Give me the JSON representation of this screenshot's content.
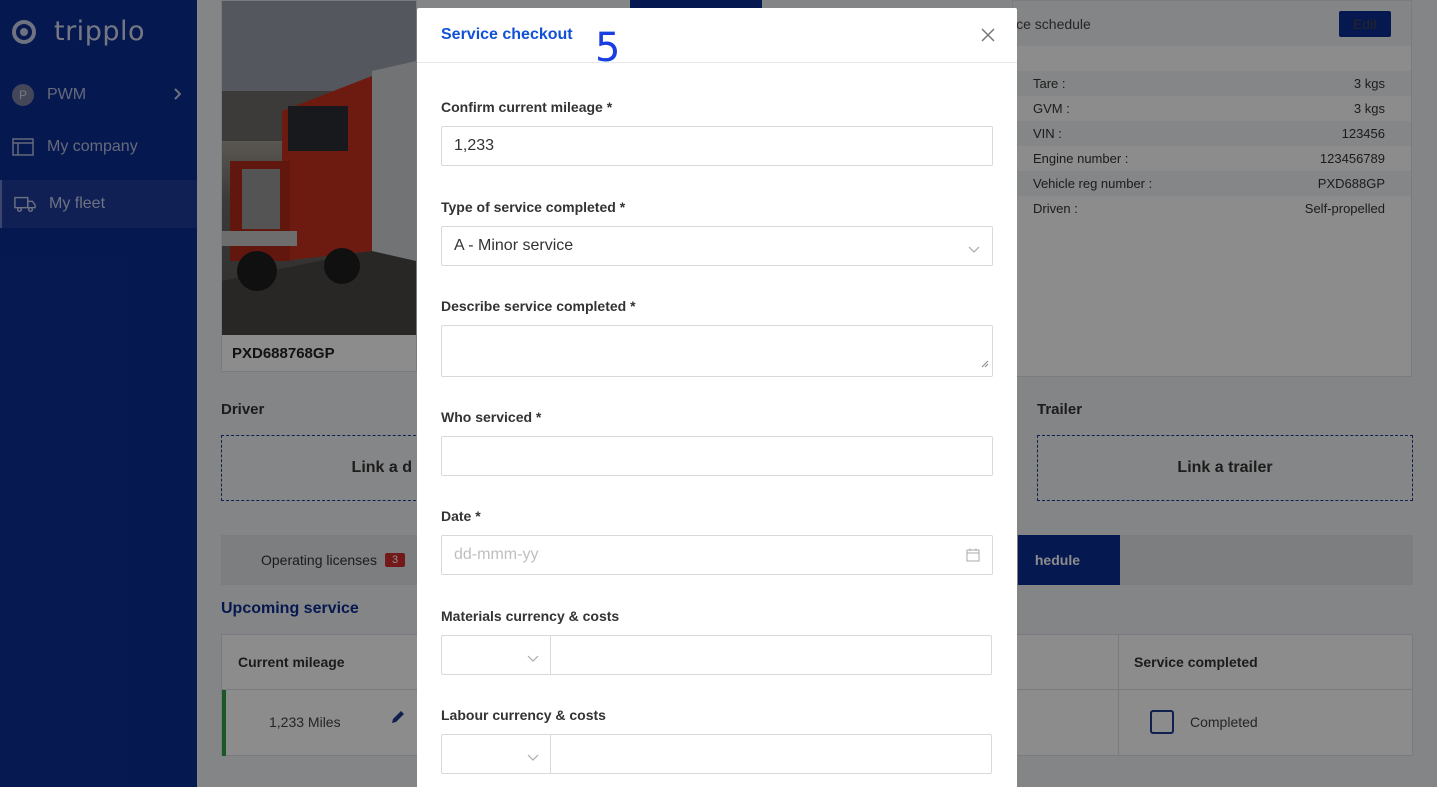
{
  "app": {
    "logo_text": "tripplo"
  },
  "sidebar": {
    "items": [
      {
        "label": "PWM",
        "avatar": "P"
      },
      {
        "label": "My company"
      },
      {
        "label": "My fleet"
      }
    ]
  },
  "vehicle": {
    "plate": "PXD688768GP",
    "schedule_header": "ice schedule",
    "edit_label": "Edit",
    "specs": [
      {
        "label": "Tare :",
        "value": "3 kgs"
      },
      {
        "label": "GVM :",
        "value": "3 kgs"
      },
      {
        "label": "VIN :",
        "value": "123456"
      },
      {
        "label": "Engine number :",
        "value": "123456789"
      },
      {
        "label": "Vehicle reg number :",
        "value": "PXD688GP"
      },
      {
        "label": "Driven :",
        "value": "Self-propelled"
      }
    ]
  },
  "links": {
    "driver_label": "Driver",
    "driver_link": "Link a d",
    "trailer_label": "Trailer",
    "trailer_link": "Link a trailer"
  },
  "tabs": {
    "operating": "Operating licenses",
    "operating_count": "3",
    "active_tab": "hedule"
  },
  "upcoming": {
    "title": "Upcoming service",
    "col_mileage": "Current mileage",
    "col_completed": "Service completed",
    "row_mileage": "1,233 Miles",
    "row_completed": "Completed"
  },
  "modal": {
    "title": "Service checkout",
    "step_overlay": "5",
    "fields": {
      "mileage_label": "Confirm current mileage *",
      "mileage_value": "1,233",
      "service_type_label": "Type of service completed *",
      "service_type_value": "A - Minor service",
      "describe_label": "Describe service completed *",
      "who_label": "Who serviced *",
      "date_label": "Date *",
      "date_placeholder": "dd-mmm-yy",
      "materials_label": "Materials currency & costs",
      "labour_label": "Labour currency & costs"
    }
  },
  "colors": {
    "sidebar": "#0b2d93",
    "accent": "#1251d6",
    "badge": "#d32f2f",
    "status_green": "#2e9d4a"
  }
}
